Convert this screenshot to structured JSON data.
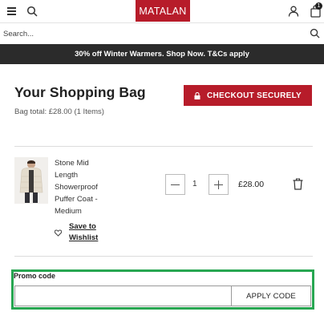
{
  "header": {
    "logo_text": "MATALAN",
    "brand_color": "#b71c2a",
    "bag_count": "1",
    "icons": [
      "menu-icon",
      "search-icon",
      "user-icon",
      "shopping-bag-icon"
    ]
  },
  "search": {
    "placeholder": "Search..."
  },
  "banner": {
    "text": "30% off Winter Warmers. Shop Now. T&Cs apply"
  },
  "bag": {
    "title": "Your Shopping Bag",
    "total": "Bag total: £28.00 (1 Items)",
    "checkout_label": "CHECKOUT SECURELY"
  },
  "item": {
    "name": "Stone Mid Length Showerproof Puffer Coat - Medium",
    "quantity": "1",
    "price": "£28.00",
    "wishlist_label": "Save to Wishlist"
  },
  "promo": {
    "label": "Promo code",
    "input_value": "",
    "apply_label": "APPLY CODE",
    "highlight_color": "#27a651"
  }
}
